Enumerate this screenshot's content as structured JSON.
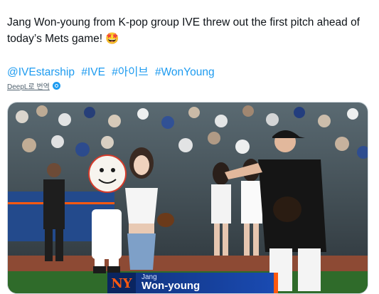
{
  "tweet": {
    "text_line1": "Jang Won-young from K-pop group IVE threw out the first pitch ahead of",
    "text_line2": "today’s Mets game! 🤩",
    "hashtags": [
      "@IVEstarship",
      "#IVE",
      "#아이브",
      "#WonYoung"
    ],
    "translate_label": "DeepL로 번역"
  },
  "media": {
    "lower_third_first": "Jang",
    "lower_third_last": "Won-young",
    "team_logo": "NY",
    "colors": {
      "mets_blue": "#1a4bb3",
      "mets_orange": "#ff5910",
      "field_green": "#2f6b2a",
      "dirt": "#8d4a34"
    }
  }
}
